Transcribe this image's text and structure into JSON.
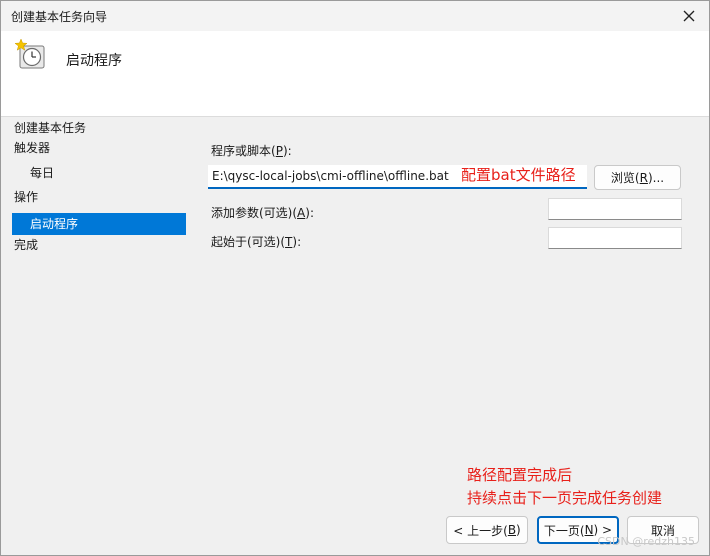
{
  "window": {
    "title": "创建基本任务向导",
    "close_icon": "close-icon"
  },
  "header": {
    "icon": "clock-task-icon",
    "title": "启动程序"
  },
  "nav": {
    "items": [
      {
        "label": "创建基本任务",
        "level": 0,
        "selected": false
      },
      {
        "label": "触发器",
        "level": 0,
        "selected": false
      },
      {
        "label": "每日",
        "level": 1,
        "selected": false
      },
      {
        "label": "操作",
        "level": 0,
        "selected": false
      },
      {
        "label": "启动程序",
        "level": 1,
        "selected": true
      },
      {
        "label": "完成",
        "level": 0,
        "selected": false
      }
    ]
  },
  "form": {
    "program_label_prefix": "程序或脚本(",
    "program_label_key": "P",
    "program_label_suffix": "):",
    "program_value": "E:\\qysc-local-jobs\\cmi-offline\\offline.bat",
    "browse_prefix": "浏览(",
    "browse_key": "R",
    "browse_suffix": ")...",
    "args_label_prefix": "添加参数(可选)(",
    "args_label_key": "A",
    "args_label_suffix": "):",
    "args_value": "",
    "start_label_prefix": "起始于(可选)(",
    "start_label_key": "T",
    "start_label_suffix": "):",
    "start_value": ""
  },
  "annotations": {
    "path_note": "配置bat文件路径",
    "bottom_note_line1": "路径配置完成后",
    "bottom_note_line2": "持续点击下一页完成任务创建"
  },
  "footer": {
    "back_prefix": "< 上一步(",
    "back_key": "B",
    "back_suffix": ")",
    "next_prefix": "下一页(",
    "next_key": "N",
    "next_suffix": ") >",
    "cancel_label": "取消"
  },
  "watermark": "CSDN @redzh135",
  "colors": {
    "accent": "#0078d7",
    "annotation_red": "#e8201a"
  }
}
